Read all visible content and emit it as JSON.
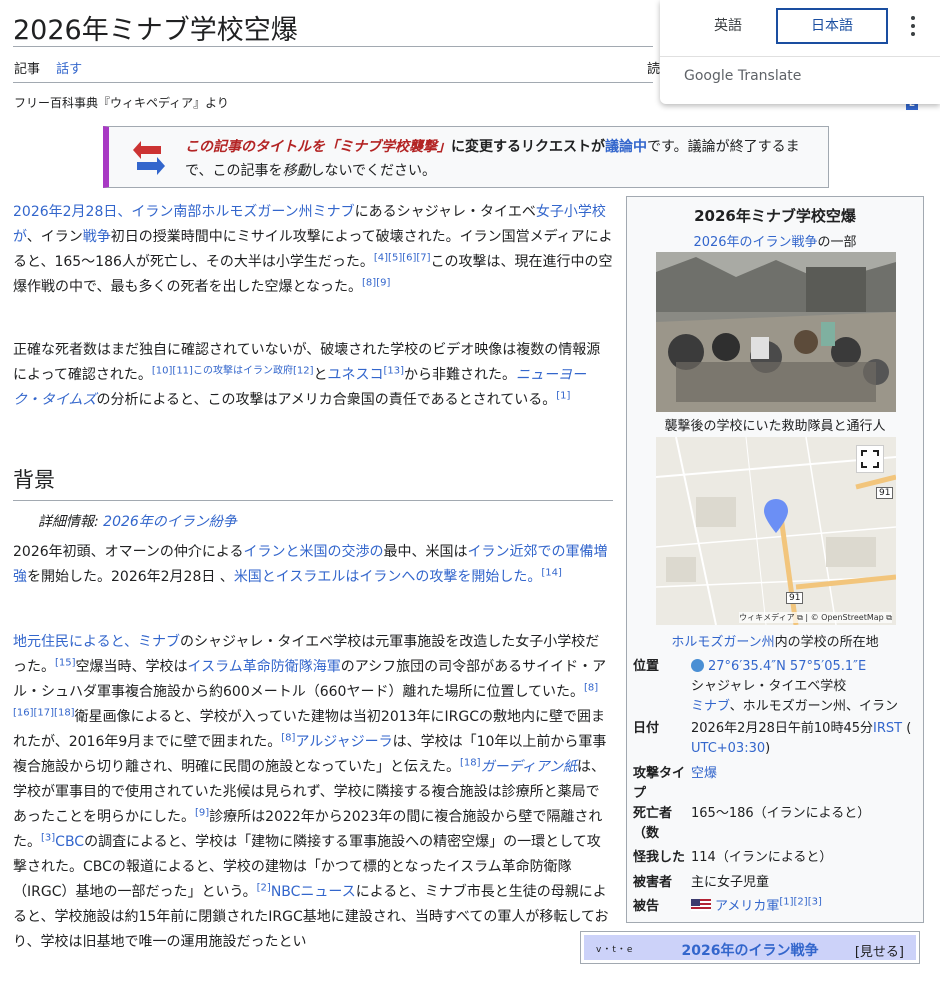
{
  "article": {
    "title": "2026年ミナブ学校空爆",
    "tabs": {
      "article": "記事",
      "talk": "話す",
      "read": "読"
    },
    "from": "フリー百科事典『ウィキペディア』より"
  },
  "notice": {
    "pre": "この記事のタイトルを「ミナブ学校襲撃」",
    "mid": "に変更するリクエストが",
    "link": "議論中",
    "post": "です。議論が終了するまで、この記事を",
    "italic": "移動",
    "end": "しないでください。"
  },
  "paragraphs": {
    "p1": {
      "l1": "2026年2月28日、イラン南部ホルモズガーン州ミナブ",
      "t1": "にあるシャジャレ・タイエベ",
      "l2": "女子小学校が",
      "t2": "、イラン",
      "l3": "戦争",
      "t3": "初日の授業時間中にミサイル攻撃によって破壊された。イラン国営メディアによると、165〜186人が死亡し、その大半は小学生だった。",
      "s1": "[4][5][6][7]",
      "t4": "この攻撃は、現在進行中の空爆作戦の中で、最も多くの死者を出した空爆となった。",
      "s2": "[8][9]"
    },
    "p2": {
      "t1": "正確な死者数はまだ独自に確認されていないが、破壊された学校のビデオ映像は複数の情報源によって確認された。",
      "s1": "[10][11]この攻撃はイラン政府[12]",
      "t2": "と",
      "l1": "ユネスコ",
      "s2": "[13]",
      "t3": "から非難された。",
      "l2": "ニューヨーク・タイムズ",
      "t4": "の分析によると、この攻撃はアメリカ合衆国の責任であるとされている。",
      "s3": "[1]"
    },
    "section": "背景",
    "hatnote_label": "詳細情報: ",
    "hatnote_link": "2026年のイラン紛争",
    "p3": {
      "t1": "2026年初頭、オマーンの仲介による",
      "l1": "イランと米国の交渉の",
      "t2": "最中、米国は",
      "l2": "イラン近郊での軍備増強",
      "t3": "を開始した。2026年2月28日 、",
      "l3": "米国とイスラエルはイランへの攻撃を開始した。",
      "s1": "[14]"
    },
    "p4": {
      "l1": "地元住民によると、ミナブ",
      "t1": "のシャジャレ・タイエベ学校は元軍事施設を改造した女子小学校だった。",
      "s1": "[15]",
      "t2": "空爆当時、学校は",
      "l2": "イスラム革命防衛隊海軍",
      "t3": "のアシフ旅団の司令部があるサイイド・アル・シュハダ軍事複合施設から約600メートル（660ヤード）離れた場所に位置していた。",
      "s2": "[8][16][17][18]",
      "t4": "衛星画像によると、学校が入っていた建物は当初2013年にIRGCの敷地内に壁で囲まれたが、2016年9月までに壁で囲まれた。",
      "s3": "[8]",
      "l3": "アルジャジーラ",
      "t5": "は、学校は「10年以上前から軍事複合施設から切り離され、明確に民間の施設となっていた」と伝えた。",
      "s4": "[18]",
      "l4": "ガーディアン紙",
      "t6": "は、学校が軍事目的で使用されていた兆候は見られず、学校に隣接する複合施設は診療所と薬局であったことを明らかにした。",
      "s5": "[9]",
      "t7": "診療所は2022年から2023年の間に複合施設から壁で隔離された。",
      "s6": "[3]",
      "l5": "CBC",
      "t8": "の調査によると、学校は「建物に隣接する軍事施設への精密空爆」の一環として攻撃された。CBCの報道によると、学校の建物は「かつて標的となったイスラム革命防衛隊（IRGC）基地の一部だった」という。",
      "s7": "[2]",
      "l6": "NBCニュース",
      "t9": "によると、ミナブ市長と生徒の母親によると、学校施設は約15年前に閉鎖されたIRGC基地に建設され、当時すべての軍人が移転しており、学校は旧基地で唯一の運用施設だったとい"
    }
  },
  "infobox": {
    "title": "2026年ミナブ学校空爆",
    "sub_link": "2026年のイラン戦争",
    "sub_text": "の一部",
    "photo_caption": "襲撃後の学校にいた救助隊員と通行人",
    "map_credit": "ウィキメディア ⧉ | © OpenStreetMap ⧉",
    "map_road": "91",
    "map_caption_link": "ホルモズガーン州",
    "map_caption_text": "内の学校の所在地",
    "rows": {
      "location_label": "位置",
      "location_coord": "27°6′35.4″N 57°5′05.1″E",
      "location_line2": "シャジャレ・タイエベ学校",
      "location_link": "ミナブ",
      "location_line3": "、ホルモズガーン州、イラン",
      "date_label": "付",
      "date_pre": "日",
      "date_value": "2026年2月28日午前10時45分",
      "date_link": "IRST",
      "date_paren": "(",
      "date_tz": "UTC+03:30",
      "date_close": ")",
      "type_label": "攻撃タイプ",
      "type_value": "空爆",
      "deaths_label": "死亡者（数",
      "deaths_value": "165〜186（イランによると）",
      "injured_label": "怪我した",
      "injured_value": "114（イランによると）",
      "victims_label": "被害者",
      "victims_value": "主に女子児童",
      "perp_label": "被告",
      "perp_value": "アメリカ軍",
      "perp_sup": "[1][2][3]"
    }
  },
  "navbox": {
    "vte": "v・t・e",
    "title": "2026年のイラン戦争",
    "show": "[見せる]"
  },
  "translate": {
    "lang_en": "英語",
    "lang_ja": "日本語",
    "brand": "Google Translate"
  },
  "colors": {
    "link": "#3366cc",
    "notice_bar": "#a839c4",
    "translate_active": "#1a4ea0"
  }
}
